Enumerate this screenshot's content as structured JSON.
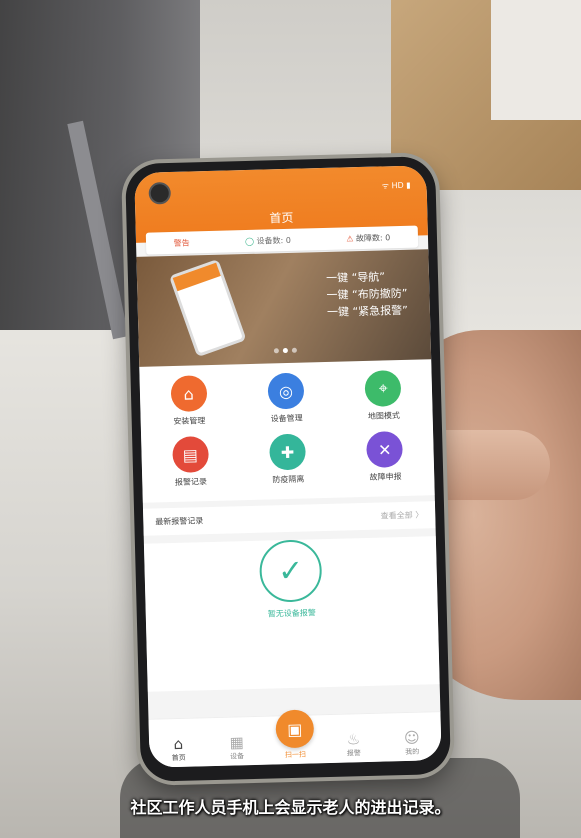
{
  "header": {
    "status": "ᯤ HD ▮",
    "title": "首页"
  },
  "stats": {
    "offline": "警告",
    "devices": "设备数: 0",
    "faults": "故障数: 0"
  },
  "banner": {
    "lines": [
      "一键 “导航”",
      "一键 “布防撤防”",
      "一键 “紧急报警”"
    ]
  },
  "grid": {
    "items": [
      {
        "label": "安装管理",
        "icon": "location-pin-icon",
        "color": "#ef6a2f",
        "glyph": "⌂"
      },
      {
        "label": "设备管理",
        "icon": "device-manage-icon",
        "color": "#3b7fe0",
        "glyph": "◎"
      },
      {
        "label": "地图模式",
        "icon": "map-icon",
        "color": "#3dbb6a",
        "glyph": "⌖"
      },
      {
        "label": "报警记录",
        "icon": "alarm-record-icon",
        "color": "#e34a3a",
        "glyph": "▤"
      },
      {
        "label": "防疫隔离",
        "icon": "shield-plus-icon",
        "color": "#34b69a",
        "glyph": "✚"
      },
      {
        "label": "故障申报",
        "icon": "tools-icon",
        "color": "#7a52d6",
        "glyph": "✕"
      }
    ]
  },
  "alerts": {
    "title": "最新报警记录",
    "more": "查看全部 〉",
    "empty": "暂无设备报警"
  },
  "tabs": {
    "home": "首页",
    "device": "设备",
    "scan": "扫一扫",
    "alarm": "报警",
    "mine": "我的"
  },
  "caption": "社区工作人员手机上会显示老人的进出记录。"
}
